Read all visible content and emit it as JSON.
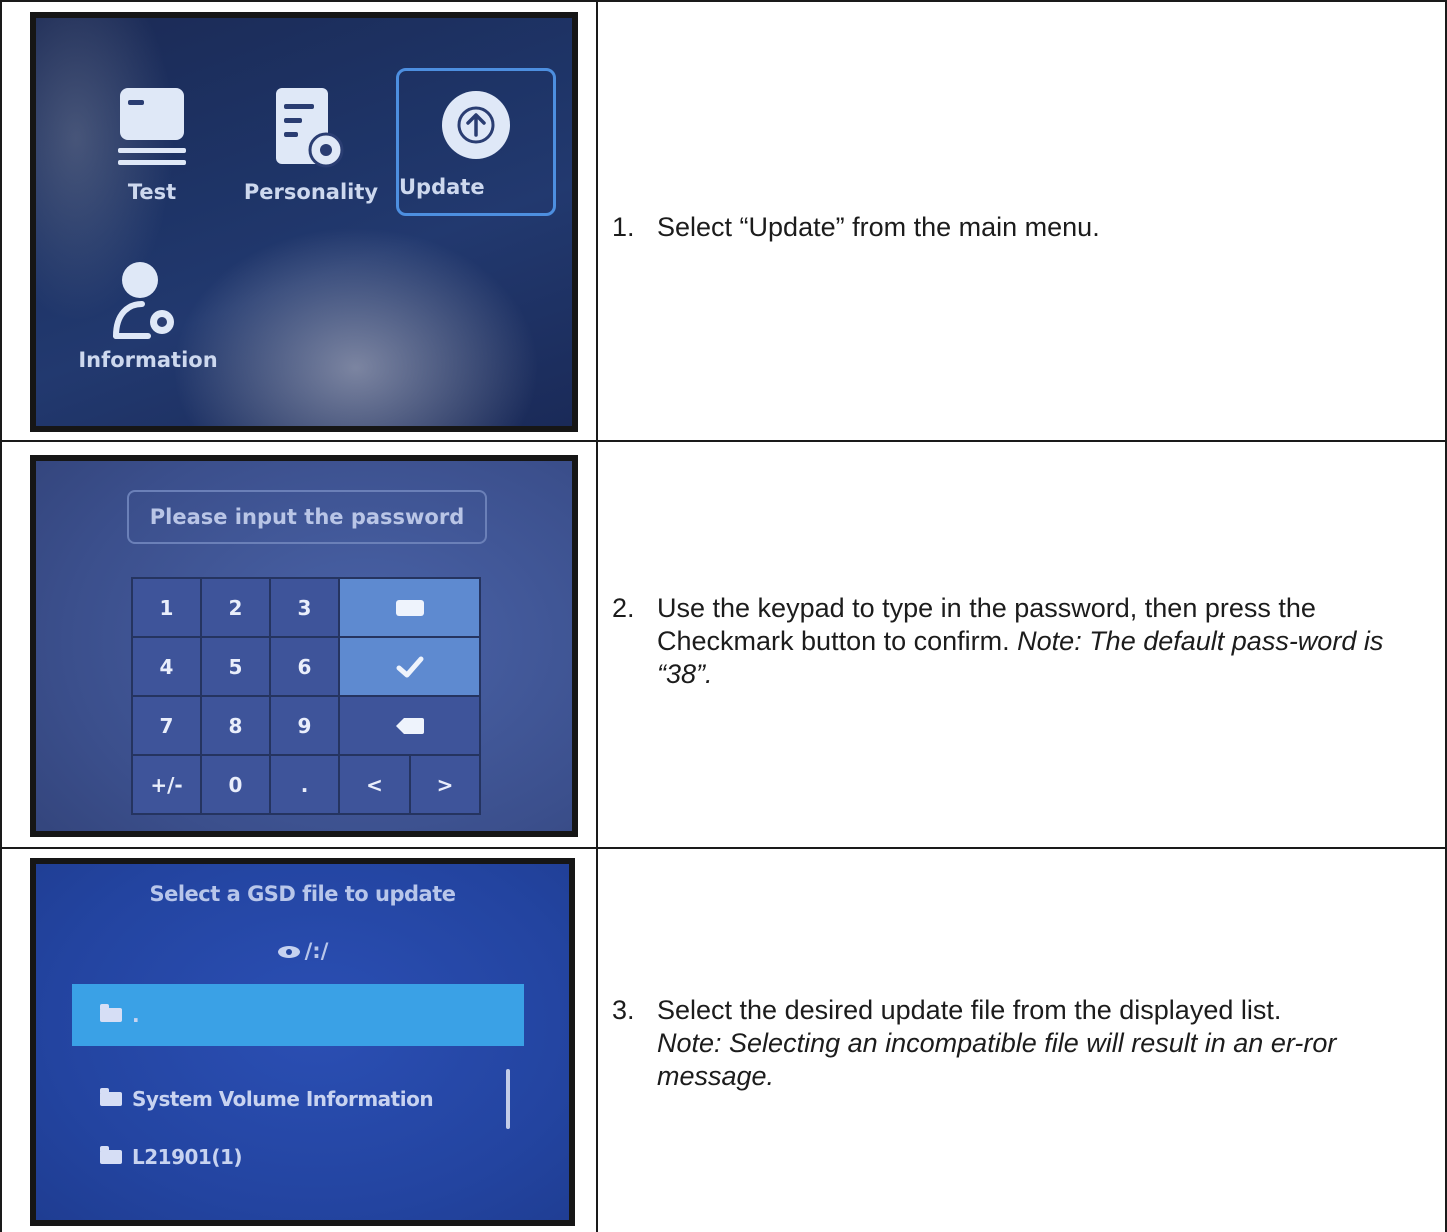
{
  "rows": [
    {
      "screen": {
        "menu": [
          {
            "label": "Test",
            "icon": "card-icon"
          },
          {
            "label": "Personality",
            "icon": "document-gear-icon"
          },
          {
            "label": "Update",
            "icon": "upload-icon",
            "selected": true
          },
          {
            "label": "Information",
            "icon": "user-gear-icon"
          }
        ]
      },
      "step_number": "1.",
      "instruction": "Select “Update” from the main menu.",
      "note": ""
    },
    {
      "screen": {
        "placeholder": "Please input the password",
        "keys": {
          "k1": "1",
          "k2": "2",
          "k3": "3",
          "k4": "4",
          "k5": "5",
          "k6": "6",
          "k7": "7",
          "k8": "8",
          "k9": "9",
          "plusminus": "+/-",
          "k0": "0",
          "dot": ".",
          "left": "<",
          "right": ">"
        }
      },
      "step_number": "2.",
      "instruction": "Use the keypad to type in the password, then press the Checkmark button to confirm.",
      "note": "Note: The default pass-word is “38”."
    },
    {
      "screen": {
        "title": "Select a GSD file to update",
        "path": "/:/",
        "files": [
          ".",
          "System Volume Information",
          "L21901(1)"
        ]
      },
      "step_number": "3.",
      "instruction": "Select the desired update file from the displayed list.",
      "note": "Note: Selecting an incompatible file will result in an er-ror message."
    }
  ],
  "colors": {
    "selection_highlight": "#3aa1e6",
    "update_outline": "#4d8fe0",
    "keypad_accent": "#5e8ad0"
  }
}
